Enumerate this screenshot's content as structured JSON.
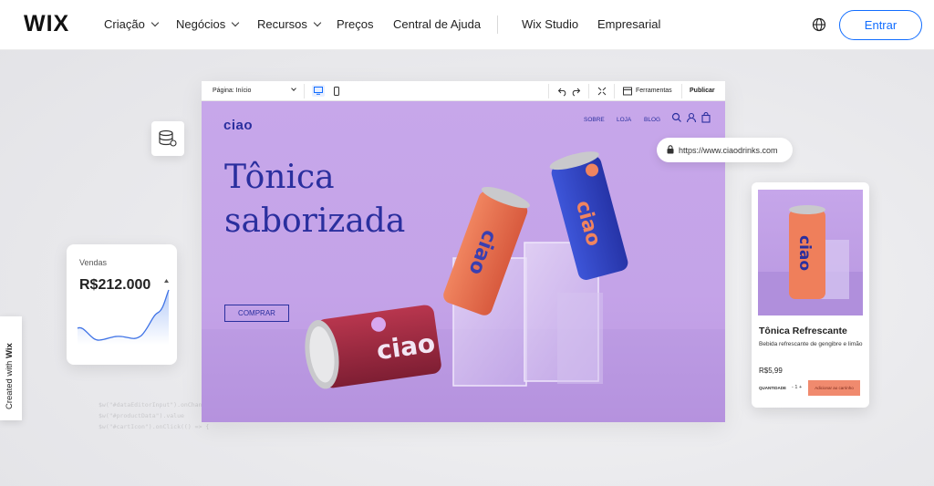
{
  "nav": {
    "logo": "WIX",
    "items": [
      {
        "label": "Criação",
        "dropdown": true
      },
      {
        "label": "Negócios",
        "dropdown": true
      },
      {
        "label": "Recursos",
        "dropdown": true
      },
      {
        "label": "Preços",
        "dropdown": false
      },
      {
        "label": "Central de Ajuda",
        "dropdown": false
      },
      {
        "label": "Wix Studio",
        "dropdown": false
      },
      {
        "label": "Empresarial",
        "dropdown": false
      }
    ],
    "login_label": "Entrar",
    "accent_color": "#116dff"
  },
  "editor": {
    "page_select": "Página: Início",
    "tools_label": "Ferramentas",
    "publish_label": "Publicar"
  },
  "site": {
    "logo": "ciao",
    "nav": [
      "SOBRE",
      "LOJA",
      "BLOG"
    ],
    "headline_line1": "Tônica",
    "headline_line2": "saborizada",
    "cta": "COMPRAR",
    "can_text": "ciao",
    "brand_color": "#2a2f9e"
  },
  "url_pill": {
    "url": "https://www.ciaodrinks.com"
  },
  "sales": {
    "label": "Vendas",
    "value": "R$212.000"
  },
  "product": {
    "title": "Tônica Refrescante",
    "description": "Bebida refrescante de gengibre e limão",
    "price": "R$5,99",
    "qty_label": "QUANTIDADE",
    "qty_value": "- 1 +",
    "add_to_cart": "Adicionar ao carrinho"
  },
  "created_with": {
    "prefix": "Created with",
    "brand": "Wix"
  },
  "background_code": [
    "$w(\"#dataEditorInput\").onChange",
    "  $w(\"#productData\").value",
    "  $w(\"#cartIcon\").onClick(() => {"
  ]
}
